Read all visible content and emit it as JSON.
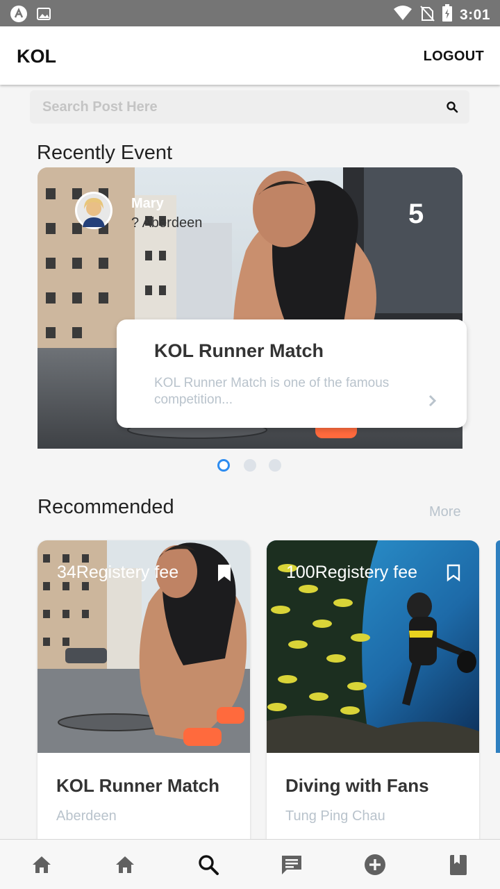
{
  "status_bar": {
    "time": "3:01",
    "left_icons": [
      "app-logo-icon",
      "image-icon"
    ],
    "right_icons": [
      "wifi-icon",
      "no-sim-icon",
      "battery-charging-icon"
    ]
  },
  "app_bar": {
    "title": "KOL",
    "logout_label": "LOGOUT"
  },
  "search": {
    "placeholder": "Search Post Here"
  },
  "recent": {
    "title": "Recently Event",
    "card": {
      "user_name": "Mary",
      "location": "? Aberdeen",
      "count": "5",
      "event_title": "KOL Runner Match",
      "description": "KOL Runner Match is one of the famous competition..."
    },
    "pager": {
      "count": 3,
      "active_index": 0
    }
  },
  "recommended": {
    "title": "Recommended",
    "more_label": "More",
    "cards": [
      {
        "fee": "34Registery fee",
        "title": "KOL Runner Match",
        "location": "Aberdeen",
        "bookmarked": true
      },
      {
        "fee": "100Registery fee",
        "title": "Diving with Fans",
        "location": "Tung Ping Chau",
        "bookmarked": false
      }
    ]
  },
  "bottom_nav": {
    "items": [
      "home-icon",
      "home-icon",
      "search-icon",
      "chat-icon",
      "add-circle-icon",
      "book-icon"
    ],
    "active_index": 2
  },
  "colors": {
    "status_bar": "#757575",
    "accent": "#2d8cf0",
    "muted_text": "#b9c3cc",
    "nav_icon": "#616161"
  }
}
